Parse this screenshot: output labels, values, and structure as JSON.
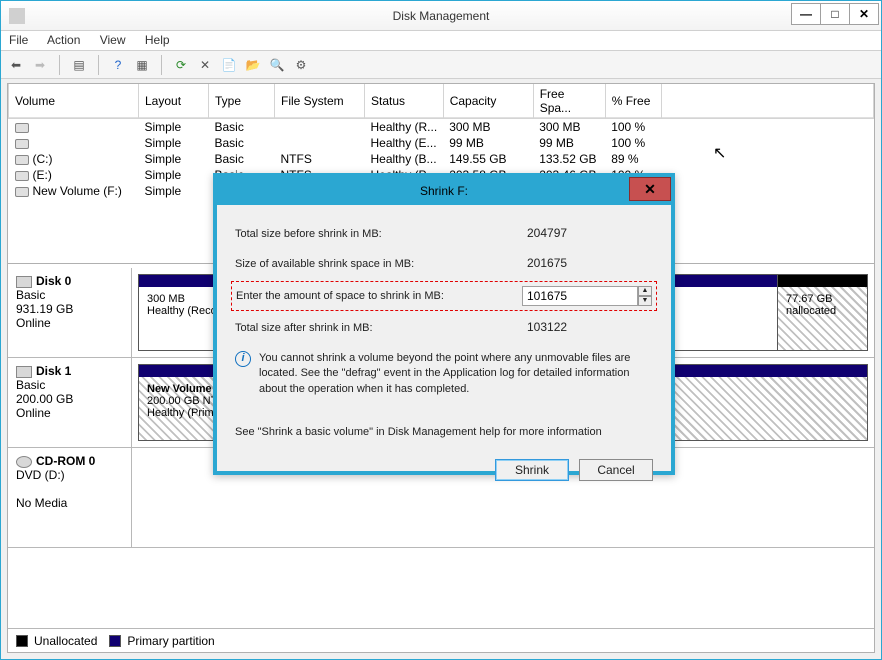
{
  "window": {
    "title": "Disk Management",
    "menu": [
      "File",
      "Action",
      "View",
      "Help"
    ]
  },
  "columns": [
    "Volume",
    "Layout",
    "Type",
    "File System",
    "Status",
    "Capacity",
    "Free Spa...",
    "% Free"
  ],
  "volumes": [
    {
      "name": "",
      "layout": "Simple",
      "type": "Basic",
      "fs": "",
      "status": "Healthy (R...",
      "cap": "300 MB",
      "free": "300 MB",
      "pct": "100 %"
    },
    {
      "name": "",
      "layout": "Simple",
      "type": "Basic",
      "fs": "",
      "status": "Healthy (E...",
      "cap": "99 MB",
      "free": "99 MB",
      "pct": "100 %"
    },
    {
      "name": "(C:)",
      "layout": "Simple",
      "type": "Basic",
      "fs": "NTFS",
      "status": "Healthy (B...",
      "cap": "149.55 GB",
      "free": "133.52 GB",
      "pct": "89 %"
    },
    {
      "name": "(E:)",
      "layout": "Simple",
      "type": "Basic",
      "fs": "NTFS",
      "status": "Healthy (P...",
      "cap": "203.58 GB",
      "free": "203.46 GB",
      "pct": "100 %"
    },
    {
      "name": "New Volume (F:)",
      "layout": "Simple",
      "type": "",
      "fs": "",
      "status": "",
      "cap": "",
      "free": "",
      "pct": ""
    }
  ],
  "disks": {
    "d0": {
      "name": "Disk 0",
      "type": "Basic",
      "size": "931.19 GB",
      "state": "Online"
    },
    "d0p1": {
      "size": "300 MB",
      "status": "Healthy (Reco"
    },
    "d0un": {
      "size": "77.67 GB",
      "status": "nallocated"
    },
    "d1": {
      "name": "Disk 1",
      "type": "Basic",
      "size": "200.00 GB",
      "state": "Online"
    },
    "d1p1": {
      "name": "New Volume  (F",
      "desc": "200.00 GB NTFS",
      "status": "Healthy (Primary"
    },
    "cd": {
      "name": "CD-ROM 0",
      "type": "DVD (D:)",
      "state": "No Media"
    }
  },
  "legend": {
    "unalloc": "Unallocated",
    "primary": "Primary partition"
  },
  "dialog": {
    "title": "Shrink F:",
    "total_before_lbl": "Total size before shrink in MB:",
    "total_before": "204797",
    "avail_lbl": "Size of available shrink space in MB:",
    "avail": "201675",
    "enter_lbl": "Enter the amount of space to shrink in MB:",
    "enter": "101675",
    "after_lbl": "Total size after shrink in MB:",
    "after": "103122",
    "note": "You cannot shrink a volume beyond the point where any unmovable files are located. See the \"defrag\" event in the Application log for detailed information about the operation when it has completed.",
    "note2": "See \"Shrink a basic volume\" in Disk Management help for more information",
    "shrink_btn": "Shrink",
    "cancel_btn": "Cancel"
  }
}
